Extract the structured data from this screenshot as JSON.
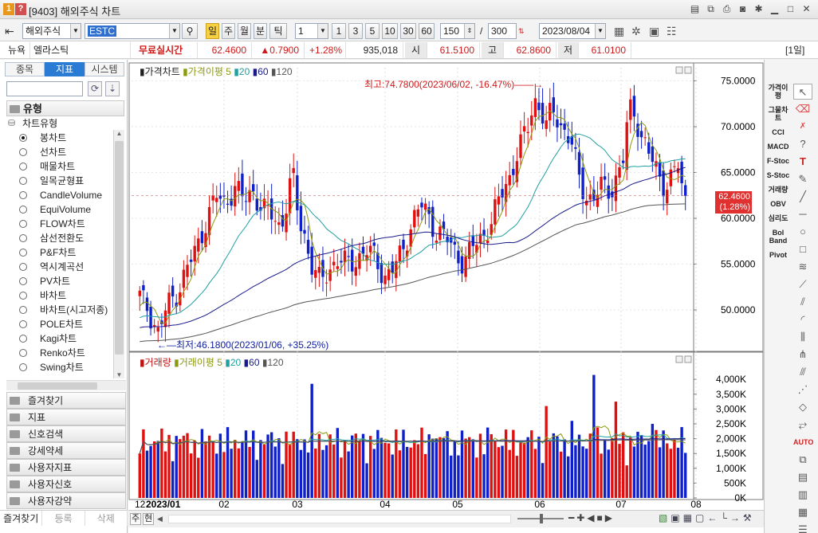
{
  "window": {
    "code_label": "[9403]",
    "title_text": "해외주식 차트",
    "badge1": "1",
    "badge2": "?"
  },
  "toolbar": {
    "market": "해외주식",
    "symbol": "ESTC",
    "period_buttons": [
      "일",
      "주",
      "월",
      "분",
      "틱"
    ],
    "period_selected": "일",
    "interval_select": "1",
    "interval_buttons": [
      "1",
      "3",
      "5",
      "10",
      "30",
      "60"
    ],
    "count": "150",
    "count_sep": "/",
    "max_count": "300",
    "date": "2023/08/04",
    "unit_label": "[1일]"
  },
  "quote": {
    "exchange": "뉴욕",
    "name": "엘라스틱",
    "realtime_label": "무료실시간",
    "price": "62.4600",
    "change": "▲0.7900",
    "change_pct": "+1.28%",
    "volume": "935,018",
    "open_label": "시",
    "open": "61.5100",
    "high_label": "고",
    "high": "62.8600",
    "low_label": "저",
    "low": "61.0100"
  },
  "left": {
    "tabs": [
      "종목",
      "지표",
      "시스템"
    ],
    "active_tab": "지표",
    "group_title": "유형",
    "subgroup": "차트유형",
    "chart_types": [
      "봉차트",
      "선차트",
      "매물차트",
      "일목균형표",
      "CandleVolume",
      "EquiVolume",
      "FLOW차트",
      "삼선전환도",
      "P&F차트",
      "역시계곡선",
      "PV차트",
      "바차트",
      "바차트(시고저종)",
      "POLE차트",
      "Kagi차트",
      "Renko차트",
      "Swing차트"
    ],
    "selected_type": "봉차트",
    "groups": [
      "즐겨찾기",
      "지표",
      "신호검색",
      "강세약세",
      "사용자지표",
      "사용자신호",
      "사용자강약"
    ],
    "bottom_tabs": [
      "즐겨찾기",
      "등록",
      "삭제"
    ]
  },
  "price_pane": {
    "legend_main": "가격차트",
    "legend_ma": "가격이평",
    "ma_periods": [
      "5",
      "20",
      "60",
      "120"
    ],
    "yticks": [
      "75.0000",
      "70.0000",
      "65.0000",
      "60.0000",
      "55.0000",
      "50.0000"
    ],
    "high_annotation": "최고:74.7800(2023/06/02, -16.47%)",
    "low_annotation": "최저:46.1800(2023/01/06, +35.25%)",
    "current_price": "62.4600",
    "current_pct": "(1.28%)"
  },
  "volume_pane": {
    "legend_main": "거래량",
    "legend_ma": "거래이평",
    "ma_periods": [
      "5",
      "20",
      "60",
      "120"
    ],
    "yticks": [
      "4,000K",
      "3,500K",
      "3,000K",
      "2,500K",
      "2,000K",
      "1,500K",
      "1,000K",
      "500K",
      "0K"
    ]
  },
  "xaxis": {
    "labels": [
      "12",
      "2023/01",
      "02",
      "03",
      "04",
      "05",
      "06",
      "07",
      "08"
    ]
  },
  "rightbar": {
    "indicators": [
      "가격이평",
      "그물차트",
      "CCI",
      "MACD",
      "F-Stoc",
      "S-Stoc",
      "거래량",
      "OBV",
      "심리도",
      "Bol Band",
      "Pivot"
    ]
  },
  "colors": {
    "up": "#e01010",
    "down": "#1020c8",
    "ma5": "#8c9a10",
    "ma20": "#20a0a0",
    "ma60": "#1a1a8a",
    "ma120": "#555555"
  },
  "chart_data": {
    "type": "candlestick",
    "title": "",
    "x_range": [
      "2022/12",
      "2023/08/04"
    ],
    "ylim": [
      46,
      76
    ],
    "volume_ylim": [
      0,
      4300
    ],
    "volume_unit": "K",
    "monthly_closes": {
      "2022-12": 51.5,
      "2023-01": 55.5,
      "2023-02": 62.0,
      "2023-03": 57.5,
      "2023-04": 55.0,
      "2023-05": 58.5,
      "2023-06": 71.0,
      "2023-07": 66.0,
      "2023-08": 62.46
    }
  }
}
